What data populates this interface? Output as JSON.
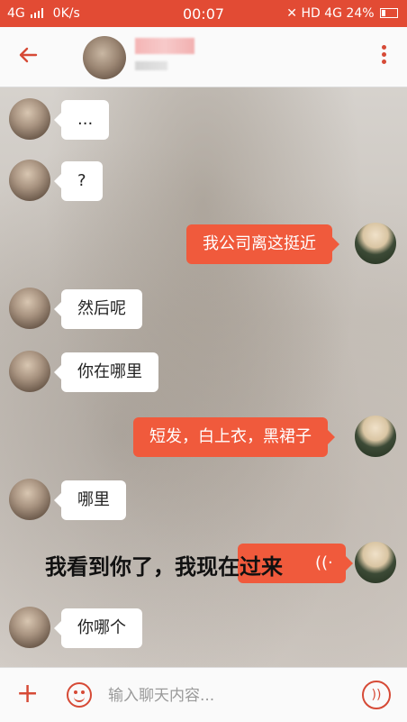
{
  "status_bar": {
    "network": "4G",
    "speed": "0K/s",
    "time": "00:07",
    "hd": "HD",
    "network_right": "4G",
    "battery": "24%"
  },
  "header": {
    "back_icon": "arrow-left-icon",
    "menu_icon": "more-vertical-icon"
  },
  "messages": [
    {
      "side": "in",
      "text": "..."
    },
    {
      "side": "in",
      "text": "?"
    },
    {
      "side": "out",
      "text": "我公司离这挺近"
    },
    {
      "side": "in",
      "text": "然后呢"
    },
    {
      "side": "in",
      "text": "你在哪里"
    },
    {
      "side": "out",
      "text": "短发，白上衣，黑裙子"
    },
    {
      "side": "in",
      "text": "哪里"
    },
    {
      "side": "out_voice",
      "text": ""
    },
    {
      "side": "in",
      "text": "你哪个"
    }
  ],
  "overlay_caption": "我看到你了，我现在过来",
  "composer": {
    "placeholder": "输入聊天内容...",
    "plus_icon": "plus-icon",
    "emoji_icon": "emoji-icon",
    "voice_icon": "voice-icon"
  },
  "colors": {
    "accent": "#e24b34",
    "outgoing_bubble": "#f05a3c",
    "incoming_bubble": "#ffffff"
  }
}
